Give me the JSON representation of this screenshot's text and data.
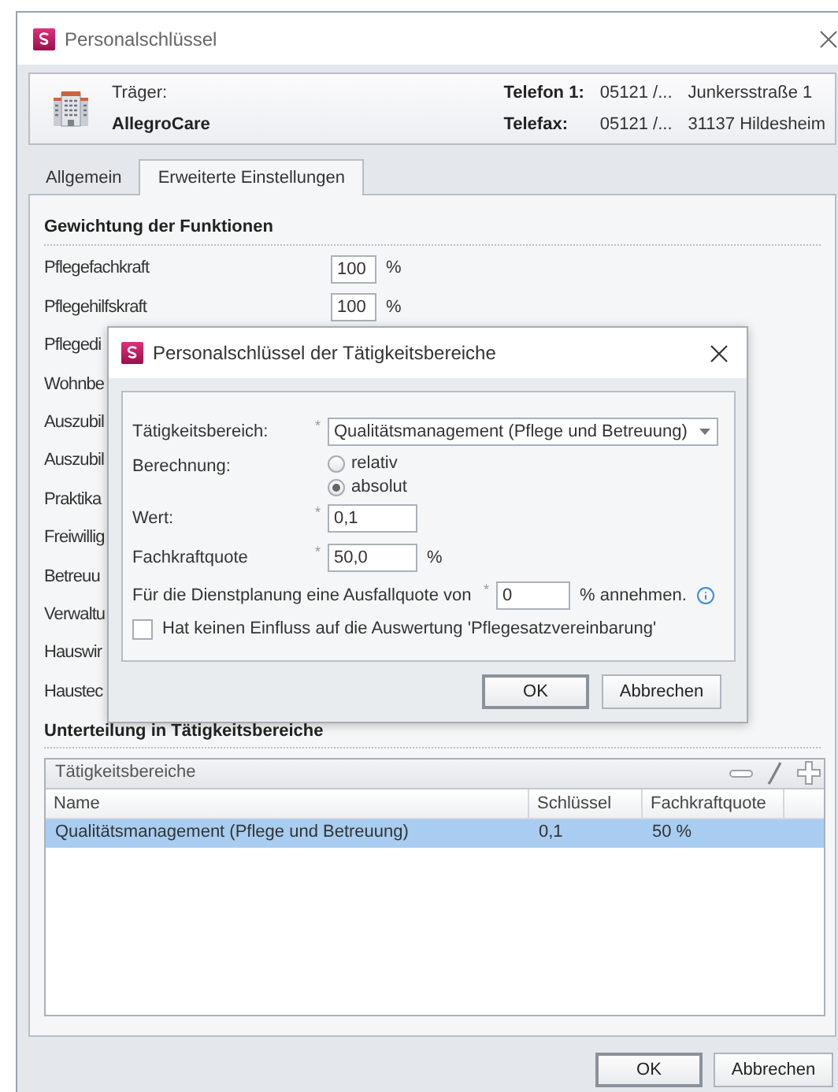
{
  "window": {
    "title": "Personalschlüssel"
  },
  "header": {
    "carrier_label": "Träger:",
    "carrier_name": "AllegroCare",
    "phone_label": "Telefon 1:",
    "phone_value": "05121 /...",
    "fax_label": "Telefax:",
    "fax_value": "05121 /...",
    "street": "Junkersstraße 1",
    "city": "31137 Hildesheim"
  },
  "tabs": [
    {
      "label": "Allgemein",
      "selected": false
    },
    {
      "label": "Erweiterte Einstellungen",
      "selected": true
    }
  ],
  "weights": {
    "title": "Gewichtung der Funktionen",
    "rows": [
      {
        "label": "Pflegefachkraft",
        "value": "100",
        "unit": "%"
      },
      {
        "label": "Pflegehilfskraft",
        "value": "100",
        "unit": "%"
      },
      {
        "label": "Pflegedi"
      },
      {
        "label": "Wohnbe"
      },
      {
        "label": "Auszubil"
      },
      {
        "label": "Auszubil"
      },
      {
        "label": "Praktika"
      },
      {
        "label": "Freiwillig"
      },
      {
        "label": "Betreuu"
      },
      {
        "label": "Verwaltu"
      },
      {
        "label": "Hauswir"
      },
      {
        "label": "Haustec"
      }
    ]
  },
  "subdivision": {
    "title": "Unterteilung in Tätigkeitsbereiche",
    "table": {
      "title": "Tätigkeitsbereiche",
      "columns": [
        "Name",
        "Schlüssel",
        "Fachkraftquote"
      ],
      "rows": [
        {
          "cells": [
            "Qualitätsmanagement (Pflege und Betreuung)",
            "0,1",
            "50 %"
          ],
          "selected": true
        }
      ]
    }
  },
  "buttons": [
    {
      "label": "OK",
      "default": true
    },
    {
      "label": "Abbrechen",
      "default": false
    }
  ],
  "dialog": {
    "title": "Personalschlüssel der Tätigkeitsbereiche",
    "required_mark": "*",
    "area": {
      "label": "Tätigkeitsbereich:",
      "value": "Qualitätsmanagement (Pflege und Betreuung)"
    },
    "calculation": {
      "label": "Berechnung:",
      "options": [
        {
          "label": "relativ",
          "selected": false
        },
        {
          "label": "absolut",
          "selected": true
        }
      ]
    },
    "value": {
      "label": "Wert:",
      "value": "0,1"
    },
    "quota": {
      "label": "Fachkraftquote",
      "value": "50,0",
      "unit": "%"
    },
    "absence": {
      "prefix": "Für die Dienstplanung eine Ausfallquote von",
      "value": "0",
      "suffix": "% annehmen."
    },
    "no_influence": {
      "label": "Hat keinen Einfluss auf die Auswertung 'Pflegesatzvereinbarung'",
      "checked": false
    },
    "buttons": [
      {
        "label": "OK",
        "default": true
      },
      {
        "label": "Abbrechen",
        "default": false
      }
    ]
  }
}
